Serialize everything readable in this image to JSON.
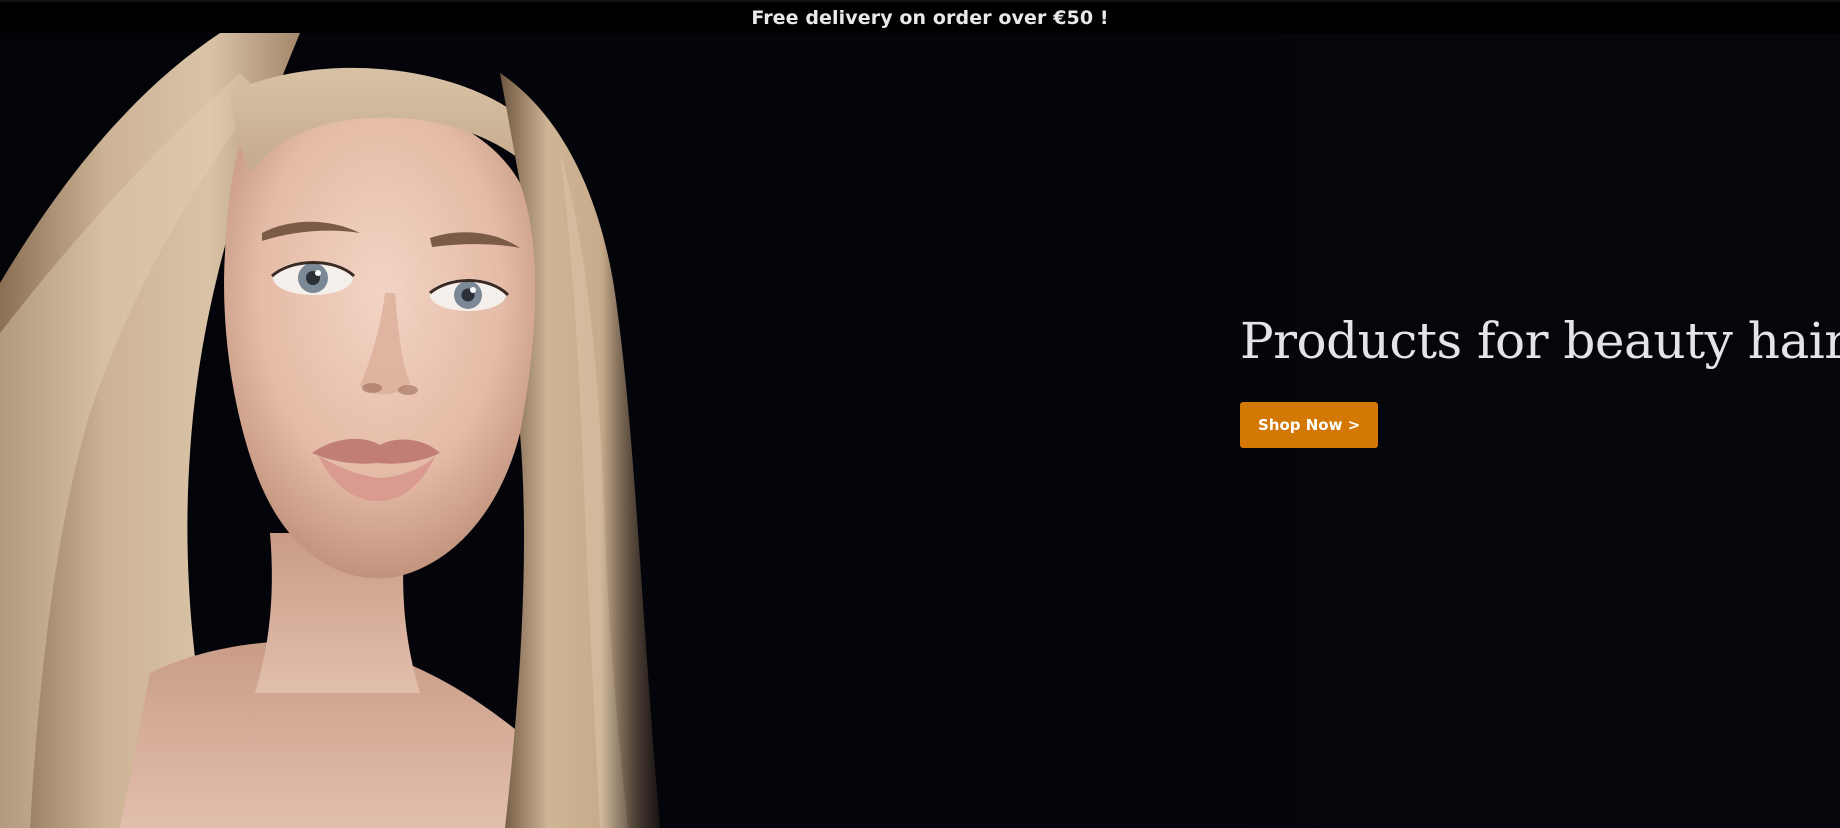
{
  "announcement": {
    "text": "Free delivery on order over €50 !"
  },
  "hero": {
    "title": "Products for beauty hair",
    "cta_label": "Shop Now >",
    "image_subject": "portrait-long-blonde-hair"
  },
  "colors": {
    "background": "#04050a",
    "announcement_bg": "#000000",
    "announcement_text": "#e9e9e9",
    "title_text": "#e6e3e6",
    "cta_bg": "#d37705",
    "cta_text": "#ffffff",
    "hair_tone": "#c9ad8c",
    "skin_tone": "#e8c3b0"
  }
}
